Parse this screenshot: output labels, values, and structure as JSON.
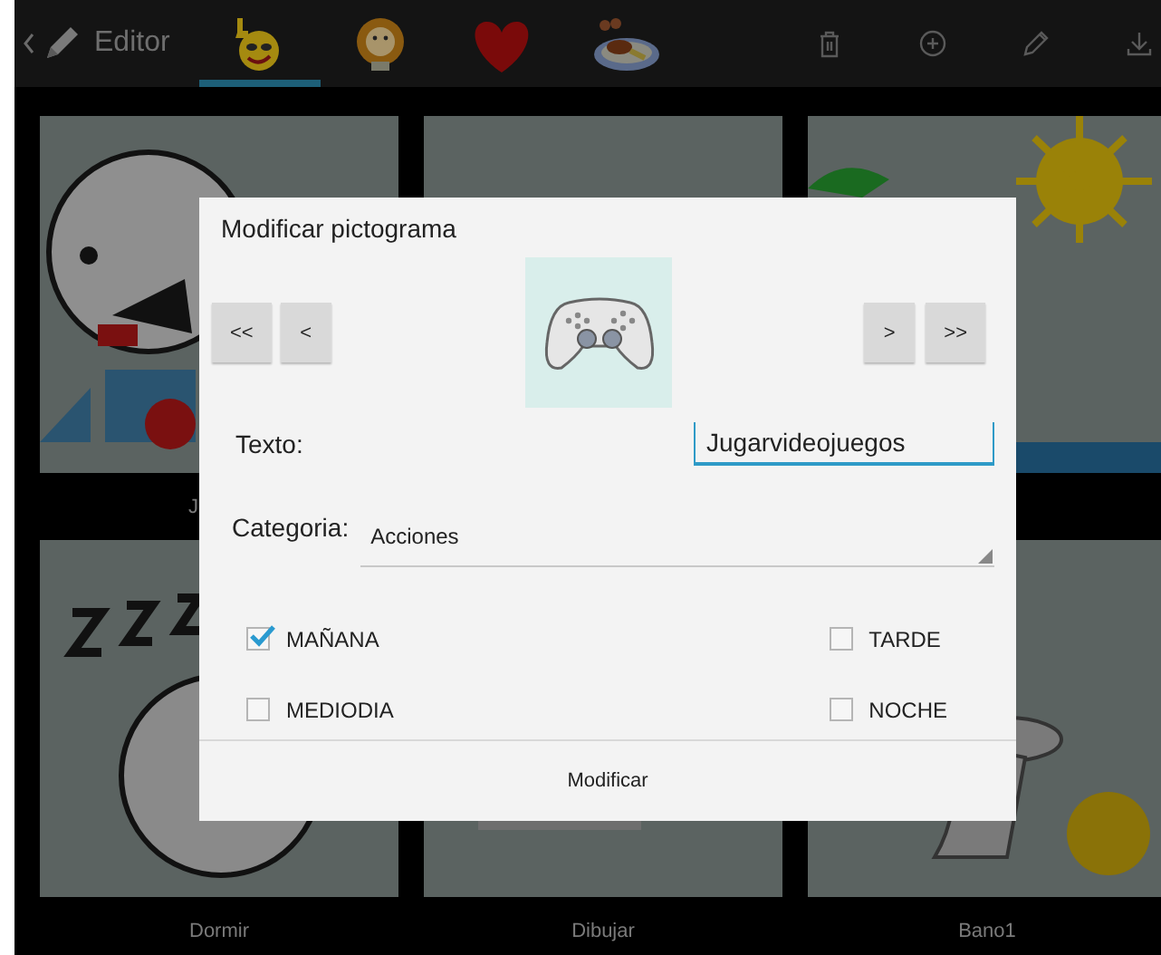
{
  "toolbar": {
    "title": "Editor",
    "tabs": [
      {
        "kind": "smiley",
        "selected": true
      },
      {
        "kind": "lion",
        "selected": false
      },
      {
        "kind": "heart",
        "selected": false
      },
      {
        "kind": "food",
        "selected": false
      }
    ],
    "actions": [
      {
        "kind": "delete"
      },
      {
        "kind": "add"
      },
      {
        "kind": "edit"
      },
      {
        "kind": "download"
      }
    ]
  },
  "tiles": [
    {
      "kind": "train-face",
      "label": "J",
      "cut_by_dialog": true
    },
    {
      "kind": "blank"
    },
    {
      "kind": "sun"
    },
    {
      "kind": "sleep",
      "label": "Dormir"
    },
    {
      "kind": "drawing",
      "label": "Dibujar"
    },
    {
      "kind": "toilet",
      "label": "Bano1"
    }
  ],
  "dialog": {
    "title": "Modificar pictograma",
    "nav_left": [
      "<<",
      "<"
    ],
    "nav_right": [
      ">",
      ">>"
    ],
    "text_label": "Texto:",
    "text_value": "Jugarvideojuegos",
    "category_label": "Categoria:",
    "category_value": "Acciones",
    "checkboxes": [
      {
        "label": "MAÑANA",
        "checked": true
      },
      {
        "label": "TARDE",
        "checked": false
      },
      {
        "label": "MEDIODIA",
        "checked": false
      },
      {
        "label": "NOCHE",
        "checked": false
      }
    ],
    "button": "Modificar"
  }
}
